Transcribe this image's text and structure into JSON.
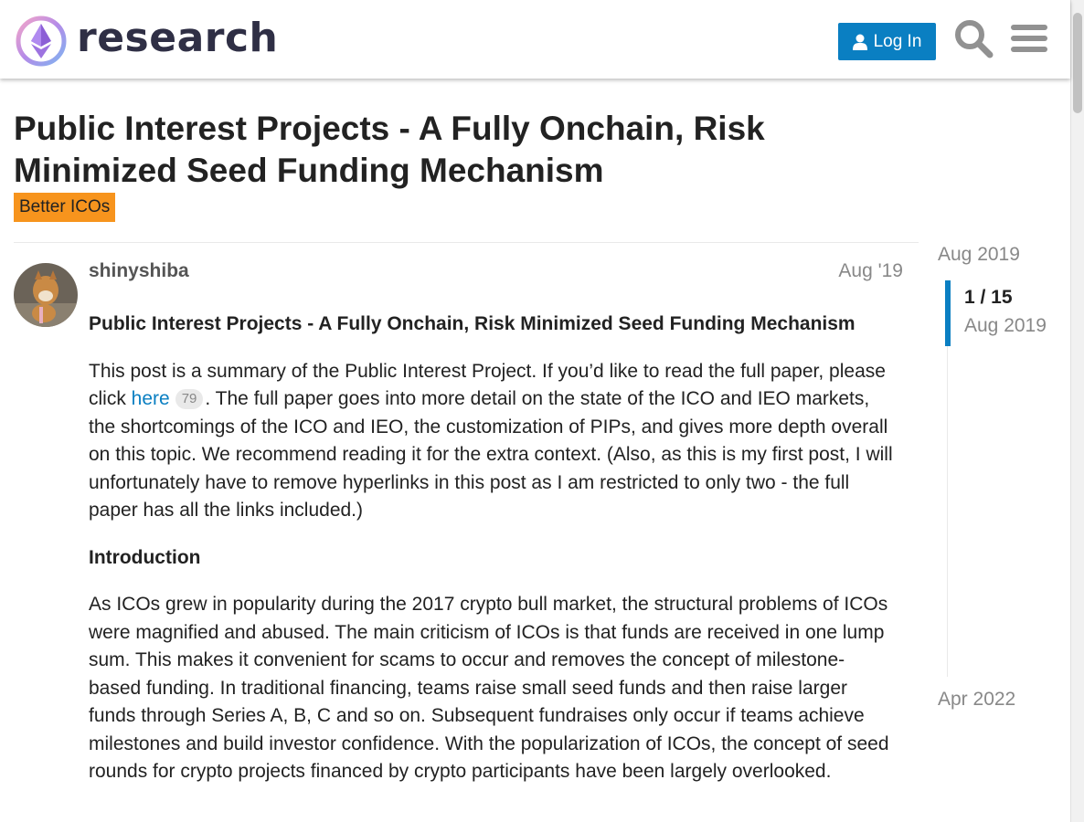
{
  "header": {
    "logo_text": "research",
    "login_label": "Log In",
    "search_icon": "search-icon",
    "menu_icon": "hamburger-menu-icon",
    "accent_color": "#0a7fc2"
  },
  "topic": {
    "title": "Public Interest Projects - A Fully Onchain, Risk Minimized Seed Funding Mechanism",
    "category": "Better ICOs",
    "category_color": "#f7941d"
  },
  "post": {
    "username": "shinyshiba",
    "date": "Aug '19",
    "heading": "Public Interest Projects - A Fully Onchain, Risk Minimized Seed Funding Mechanism",
    "para1_before": "This post is a summary of the Public Interest Project. If you’d like to read the full paper, please click ",
    "link_text": "here",
    "link_clicks": "79",
    "para1_after": ". The full paper goes into more detail on the state of the ICO and IEO markets, the shortcomings of the ICO and IEO, the customization of PIPs, and gives more depth overall on this topic. We recommend reading it for the extra context. (Also, as this is my first post, I will unfortunately have to remove hyperlinks in this post as I am restricted to only two - the full paper has all the links included.)",
    "section_heading": "Introduction",
    "para2": "As ICOs grew in popularity during the 2017 crypto bull market, the structural problems of ICOs were magnified and abused. The main criticism of ICOs is that funds are received in one lump sum. This makes it convenient for scams to occur and removes the concept of milestone-based funding. In traditional financing, teams raise small seed funds and then raise larger funds through Series A, B, C and so on. Subsequent fundraises only occur if teams achieve milestones and build investor confidence. With the popularization of ICOs, the concept of seed rounds for crypto projects financed by crypto participants have been largely overlooked."
  },
  "timeline": {
    "start_date": "Aug 2019",
    "position": "1 / 15",
    "position_date": "Aug 2019",
    "end_date": "Apr 2022"
  }
}
